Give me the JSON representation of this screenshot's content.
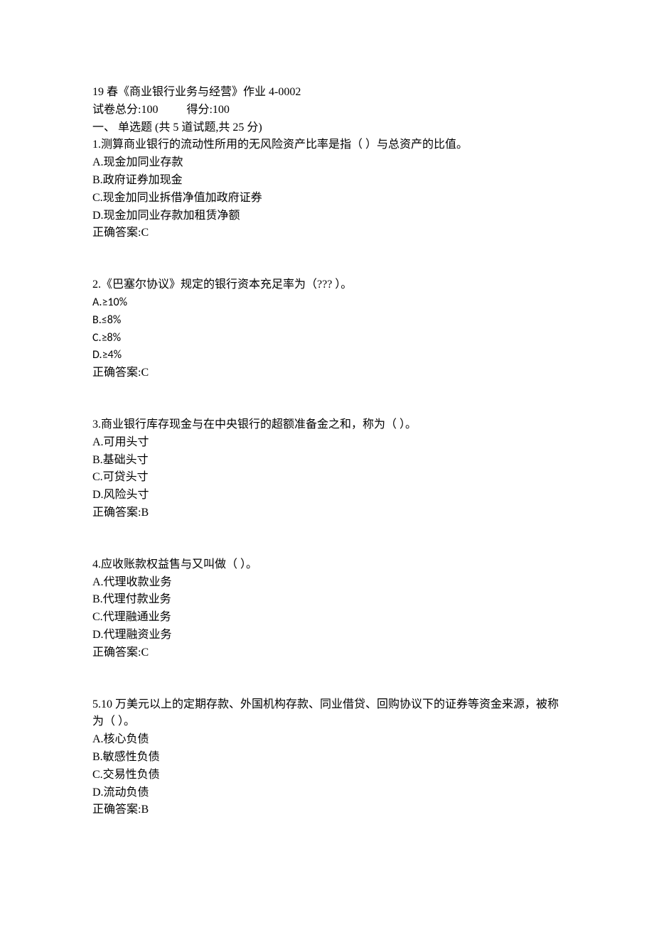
{
  "header": {
    "title_line": "19 春《商业银行业务与经营》作业 4-0002",
    "score_total_label": "试卷总分:100",
    "score_got_label": "得分:100",
    "section_line": "一、  单选题 (共  5  道试题,共  25  分)"
  },
  "questions": [
    {
      "stem": "1.测算商业银行的流动性所用的无风险资产比率是指（  ）与总资产的比值。",
      "options": [
        "A.现金加同业存款",
        "B.政府证券加现金",
        "C.现金加同业拆借净值加政府证券",
        "D.现金加同业存款加租赁净额"
      ],
      "answer": "正确答案:C"
    },
    {
      "stem": "2.《巴塞尔协议》规定的银行资本充足率为（???  ）。",
      "options": [
        "A.≥10%",
        "B.≤8%",
        "C.≥8%",
        "D.≥4%"
      ],
      "answer": "正确答案:C"
    },
    {
      "stem": "3.商业银行库存现金与在中央银行的超额准备金之和，称为（  ）。",
      "options": [
        "A.可用头寸",
        "B.基础头寸",
        "C.可贷头寸",
        "D.风险头寸"
      ],
      "answer": "正确答案:B"
    },
    {
      "stem": "4.应收账款权益售与又叫做（  ）。",
      "options": [
        "A.代理收款业务",
        "B.代理付款业务",
        "C.代理融通业务",
        "D.代理融资业务"
      ],
      "answer": "正确答案:C"
    },
    {
      "stem": "5.10 万美元以上的定期存款、外国机构存款、同业借贷、回购协议下的证券等资金来源，被称为（  ）。",
      "options": [
        "A.核心负债",
        "B.敏感性负债",
        "C.交易性负债",
        "D.流动负债"
      ],
      "answer": "正确答案:B"
    }
  ]
}
